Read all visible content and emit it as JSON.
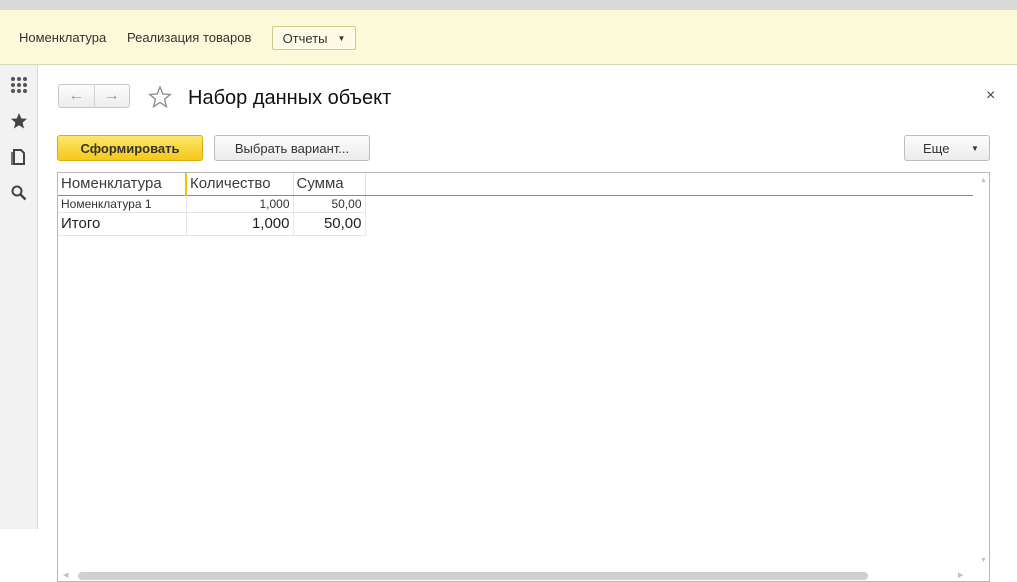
{
  "navbar": {
    "links": [
      "Номенклатура",
      "Реализация товаров"
    ],
    "reports_label": "Отчеты"
  },
  "sidebar": {
    "icons": [
      "apps-grid-icon",
      "favorites-star-icon",
      "history-icon",
      "search-icon"
    ]
  },
  "form": {
    "title": "Набор данных объект",
    "close_glyph": "×",
    "generate_label": "Сформировать",
    "choose_variant_label": "Выбрать вариант...",
    "more_label": "Еще"
  },
  "report": {
    "columns": [
      "Номенклатура",
      "Количество",
      "Сумма"
    ],
    "rows": [
      [
        "Номенклатура 1",
        "1,000",
        "50,00"
      ]
    ],
    "total": [
      "Итого",
      "1,000",
      "50,00"
    ]
  },
  "colors": {
    "navbar_bg": "#fbf9d7",
    "primary_button": "#f5c819",
    "accent_column_marker": "#f2c200"
  }
}
